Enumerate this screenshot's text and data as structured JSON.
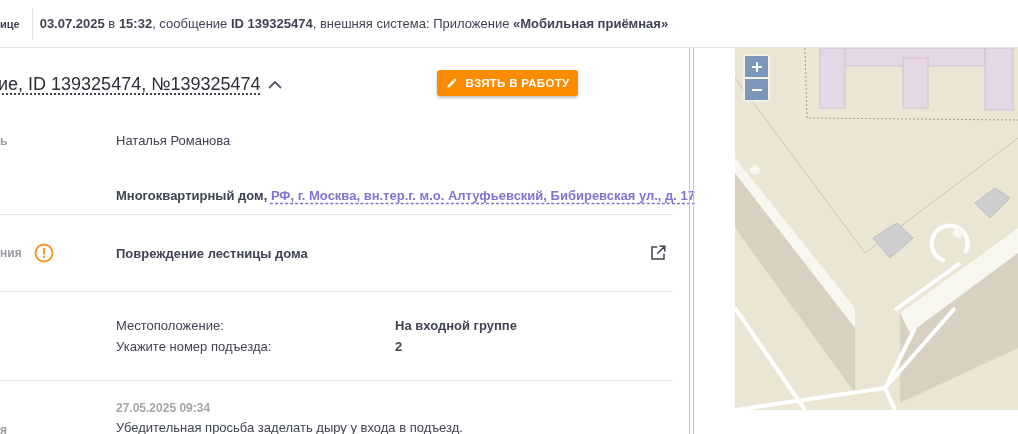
{
  "top_bar": {
    "tab_label": "ице",
    "info": "**03.07.2025** в **15:32**, сообщение **ID 139325474**, внешняя система: Приложение **«Мобильная приёмная»**"
  },
  "request": {
    "title": "ие, ID 139325474, №139325474",
    "expanded": true,
    "action_button": "ВЗЯТЬ В РАБОТУ"
  },
  "applicant": {
    "label": "ь",
    "name": "Наталья Романова",
    "object_type": "Многоквартирный дом,",
    "address": "РФ, г. Москва, вн.тер.г. м.о. Алтуфьевский, Бибиревская ул., д. 17"
  },
  "problem": {
    "label": "ния",
    "warning": true,
    "value": "Повреждение лестницы дома"
  },
  "details": {
    "fields": [
      {
        "name": "Местоположение:",
        "value": "На входной группе"
      },
      {
        "name": "Укажите номер подъезда:",
        "value": "2"
      }
    ]
  },
  "comment": {
    "label": "я",
    "date": "27.05.2025 09:34",
    "text": "Убедительная просьба заделать дыру у входа в подъезд."
  }
}
